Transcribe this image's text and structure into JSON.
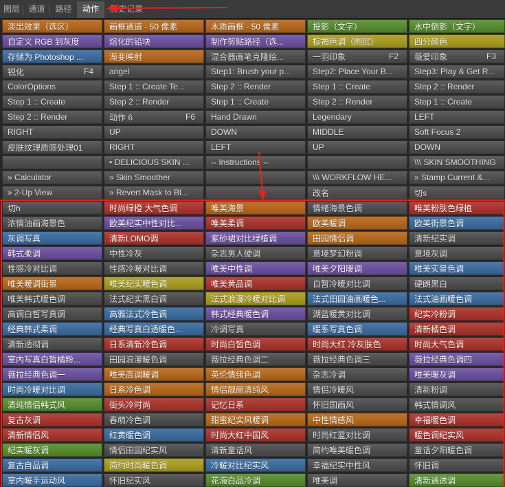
{
  "panel": {
    "tabs": [
      {
        "label": "图层",
        "active": false
      },
      {
        "label": "通道",
        "active": false
      },
      {
        "label": "路径",
        "active": false
      },
      {
        "label": "动作",
        "active": true
      },
      {
        "label": "历史记录",
        "active": false
      }
    ]
  },
  "colors": {
    "red": "#a7352e",
    "orange": "#b2671d",
    "yellow": "#a69a22",
    "green": "#568a2f",
    "blue": "#3c6a9c",
    "violet": "#6a509c",
    "gray": "#4d4d4d",
    "annotation": "#e8211c"
  },
  "actions": [
    [
      {
        "label": "淡出效果（选区）",
        "color": "orange"
      },
      {
        "label": "画框通道 - 50 像素",
        "color": "orange"
      },
      {
        "label": "木质画框 - 50 像素",
        "color": "orange"
      },
      {
        "label": "投影（文字）",
        "color": "green"
      },
      {
        "label": "水中倒影（文字）",
        "color": "green"
      }
    ],
    [
      {
        "label": "自定义 RGB 到灰度",
        "color": "violet"
      },
      {
        "label": "熔化的铅块",
        "color": "violet"
      },
      {
        "label": "制作剪贴路径（选...",
        "color": "violet"
      },
      {
        "label": "棕褐色调（图层）",
        "color": "yellow"
      },
      {
        "label": "四分颜色",
        "color": "yellow"
      }
    ],
    [
      {
        "label": "存储为 Photoshop ...",
        "color": "blue"
      },
      {
        "label": "渐变映射",
        "color": "orange"
      },
      {
        "label": "混合器画笔克隆绘...",
        "color": "gray"
      },
      {
        "label": "一羽印象",
        "key": "F2",
        "color": "gray"
      },
      {
        "label": "薇爱印象",
        "key": "F3",
        "color": "gray"
      }
    ],
    [
      {
        "label": "锐化",
        "key": "F4",
        "color": "gray"
      },
      {
        "label": "angel",
        "color": "gray"
      },
      {
        "label": "Step1: Brush your p...",
        "color": "gray"
      },
      {
        "label": "Step2: Place Your B...",
        "color": "gray"
      },
      {
        "label": "Step3: Play & Get R...",
        "color": "gray"
      }
    ],
    [
      {
        "label": "ColorOptions",
        "color": "gray"
      },
      {
        "label": "Step 1 :: Create Te...",
        "color": "gray"
      },
      {
        "label": "Step 2 :: Render",
        "color": "gray"
      },
      {
        "label": "Step 1 :: Create",
        "color": "gray"
      },
      {
        "label": "Step 2 :: Render",
        "color": "gray"
      }
    ],
    [
      {
        "label": "Step 1 :: Create",
        "color": "gray"
      },
      {
        "label": "Step 2 :: Render",
        "color": "gray"
      },
      {
        "label": "Step 1 :: Create",
        "color": "gray"
      },
      {
        "label": "Step 2 :: Render",
        "color": "gray"
      },
      {
        "label": "Step 1 :: Create",
        "color": "gray"
      }
    ],
    [
      {
        "label": "Step 2 :: Render",
        "color": "gray"
      },
      {
        "label": "动作 6",
        "key": "F6",
        "color": "gray"
      },
      {
        "label": "Hand Drawn",
        "color": "gray"
      },
      {
        "label": "Legendary",
        "color": "gray"
      },
      {
        "label": "LEFT",
        "color": "gray"
      }
    ],
    [
      {
        "label": "RIGHT",
        "color": "gray"
      },
      {
        "label": "UP",
        "color": "gray"
      },
      {
        "label": "DOWN",
        "color": "gray"
      },
      {
        "label": "MIDDLE",
        "color": "gray"
      },
      {
        "label": "Soft Focus 2",
        "color": "gray"
      }
    ],
    [
      {
        "label": "皮肤纹理质感处理01",
        "color": "gray"
      },
      {
        "label": "RIGHT",
        "color": "gray"
      },
      {
        "label": "LEFT",
        "color": "gray"
      },
      {
        "label": "UP",
        "color": "gray"
      },
      {
        "label": "DOWN",
        "color": "gray"
      }
    ],
    [
      {
        "color": "gray"
      },
      {
        "label": "• DELICIOUS SKIN ...",
        "color": "gray"
      },
      {
        "label": "-- Instructions --",
        "color": "gray"
      },
      {
        "color": "gray"
      },
      {
        "label": "\\\\\\ SKIN SMOOTHING",
        "color": "gray"
      }
    ],
    [
      {
        "label": "» Calculator",
        "color": "gray"
      },
      {
        "label": "» Skin Smoother",
        "color": "gray"
      },
      {
        "color": "gray"
      },
      {
        "label": "\\\\\\ WORKFLOW HE...",
        "color": "gray"
      },
      {
        "label": "» Stamp Current &...",
        "color": "gray"
      }
    ],
    [
      {
        "label": "» 2-Up View",
        "color": "gray"
      },
      {
        "label": "» Revert Mask to Bl...",
        "color": "gray"
      },
      {
        "color": "gray"
      },
      {
        "label": "改名",
        "color": "gray"
      },
      {
        "label": "切s",
        "color": "gray"
      }
    ],
    [
      {
        "label": "切h",
        "color": "gray"
      },
      {
        "label": "时尚绿橙 大气色调",
        "color": "red"
      },
      {
        "label": "唯美海景",
        "color": "orange"
      },
      {
        "label": "情绪海景色调",
        "color": "gray"
      },
      {
        "label": "唯美粉肤色绿植",
        "color": "red"
      }
    ],
    [
      {
        "label": "浓情油画海景色",
        "color": "gray"
      },
      {
        "label": "欧美纪实中性对比...",
        "color": "violet"
      },
      {
        "label": "唯美柔调",
        "color": "red"
      },
      {
        "label": "欧美暖调",
        "color": "orange"
      },
      {
        "label": "欧美街景色调",
        "color": "blue"
      }
    ],
    [
      {
        "label": "灰调写真",
        "color": "blue"
      },
      {
        "label": "清新LOMO调",
        "color": "red"
      },
      {
        "label": "紫砂裙对比绿植调",
        "color": "violet"
      },
      {
        "label": "田园情侣调",
        "color": "orange"
      },
      {
        "label": "清新纪实调",
        "color": "gray"
      }
    ],
    [
      {
        "label": "韩式柔调",
        "color": "violet"
      },
      {
        "label": "中性冷灰",
        "color": "gray"
      },
      {
        "label": "杂志男人硬调",
        "color": "gray"
      },
      {
        "label": "意境梦幻粉调",
        "color": "gray"
      },
      {
        "label": "意境灰调",
        "color": "gray"
      }
    ],
    [
      {
        "label": "性感冷对比调",
        "color": "gray"
      },
      {
        "label": "性感冷暖对比调",
        "color": "gray"
      },
      {
        "label": "唯美中性调",
        "color": "violet"
      },
      {
        "label": "唯美夕阳暖调",
        "color": "violet"
      },
      {
        "label": "唯美实景色调",
        "color": "blue"
      }
    ],
    [
      {
        "label": "唯美暖调街景",
        "color": "orange"
      },
      {
        "label": "唯美纪实暖色调",
        "color": "yellow"
      },
      {
        "label": "唯美黄品调",
        "color": "red"
      },
      {
        "label": "自暂冷暖对比调",
        "color": "gray"
      },
      {
        "label": "硬朗黑白",
        "color": "gray"
      }
    ],
    [
      {
        "label": "唯美韩式暖色调",
        "color": "gray"
      },
      {
        "label": "法式纪实黑白调",
        "color": "gray"
      },
      {
        "label": "法式浪漫冷暖对比调",
        "color": "yellow"
      },
      {
        "label": "法式田园油画暖色...",
        "color": "blue"
      },
      {
        "label": "法式油画暖色调",
        "color": "blue"
      }
    ],
    [
      {
        "label": "高调白皙写真调",
        "color": "gray"
      },
      {
        "label": "高雅法式冷色调",
        "color": "blue"
      },
      {
        "label": "韩式经典暖色调",
        "color": "violet"
      },
      {
        "label": "湖蓝暖黄对比调",
        "color": "gray"
      },
      {
        "label": "纪实冷粉调",
        "color": "red"
      }
    ],
    [
      {
        "label": "经典韩式柔调",
        "color": "blue"
      },
      {
        "label": "经典写真白透暖色...",
        "color": "blue"
      },
      {
        "label": "冷调写真",
        "color": "gray"
      },
      {
        "label": "暖系写真色调",
        "color": "blue"
      },
      {
        "label": "清新橘色调",
        "color": "red"
      }
    ],
    [
      {
        "label": "清新透彻调",
        "color": "gray"
      },
      {
        "label": "日系清新冷色调",
        "color": "red"
      },
      {
        "label": "时尚白皙色调",
        "color": "red"
      },
      {
        "label": "时尚大红 冷灰肤色",
        "color": "red"
      },
      {
        "label": "时尚大气色调",
        "color": "red"
      }
    ],
    [
      {
        "label": "室内写真白皙橘粉...",
        "color": "violet"
      },
      {
        "label": "田园浪漫暖色调",
        "color": "gray"
      },
      {
        "label": "薇拉经典色调二",
        "color": "gray"
      },
      {
        "label": "薇拉经典色调三",
        "color": "gray"
      },
      {
        "label": "薇拉经典色调四",
        "color": "violet"
      }
    ],
    [
      {
        "label": "薇拉经典色调一",
        "color": "violet"
      },
      {
        "label": "唯美高调暖调",
        "color": "orange"
      },
      {
        "label": "英伦情绪色调",
        "color": "orange"
      },
      {
        "label": "杂志冷调",
        "color": "gray"
      },
      {
        "label": "唯美暖灰调",
        "color": "violet"
      }
    ],
    [
      {
        "label": "时尚冷暖对比调",
        "color": "blue"
      },
      {
        "label": "日系冷色调",
        "color": "orange"
      },
      {
        "label": "情侣靓丽清纯风",
        "color": "orange"
      },
      {
        "label": "情侣冷暖风",
        "color": "gray"
      },
      {
        "label": "清新粉调",
        "color": "gray"
      }
    ],
    [
      {
        "label": "清纯情侣韩式风",
        "color": "green"
      },
      {
        "label": "街头冷时尚",
        "color": "red"
      },
      {
        "label": "记忆日系",
        "color": "red"
      },
      {
        "label": "怀旧国画风",
        "color": "gray"
      },
      {
        "label": "韩式情调风",
        "color": "gray"
      }
    ],
    [
      {
        "label": "复古灰调",
        "color": "red"
      },
      {
        "label": "春萌冷色调",
        "color": "gray"
      },
      {
        "label": "甜蜜纪实风暖调",
        "color": "orange"
      },
      {
        "label": "中性情感风",
        "color": "orange"
      },
      {
        "label": "幸福暖色调",
        "color": "red"
      }
    ],
    [
      {
        "label": "清新情侣风",
        "color": "red"
      },
      {
        "label": "红黄暖色调",
        "color": "blue"
      },
      {
        "label": "时尚大红中国风",
        "color": "red"
      },
      {
        "label": "时尚红蓝对比调",
        "color": "gray"
      },
      {
        "label": "暖色调纪实风",
        "color": "red"
      }
    ],
    [
      {
        "label": "纪实暖灰调",
        "color": "green"
      },
      {
        "label": "情侣田园纪实风",
        "color": "gray"
      },
      {
        "label": "清新童话风",
        "color": "gray"
      },
      {
        "label": "简约唯美暖色调",
        "color": "gray"
      },
      {
        "label": "童话夕阳暖色调",
        "color": "gray"
      }
    ],
    [
      {
        "label": "复古自品调",
        "color": "blue"
      },
      {
        "label": "简约时尚暖色调",
        "color": "yellow"
      },
      {
        "label": "冷暖对比纪实风",
        "color": "blue"
      },
      {
        "label": "幸福纪实中性风",
        "color": "gray"
      },
      {
        "label": "怀旧调",
        "color": "gray"
      }
    ],
    [
      {
        "label": "室内暖手运动风",
        "color": "blue"
      },
      {
        "label": "怀旧纪实风",
        "color": "gray"
      },
      {
        "label": "花海白品冷调",
        "color": "green"
      },
      {
        "label": "唯美调",
        "color": "gray"
      },
      {
        "label": "清新通透调",
        "color": "green"
      }
    ]
  ]
}
